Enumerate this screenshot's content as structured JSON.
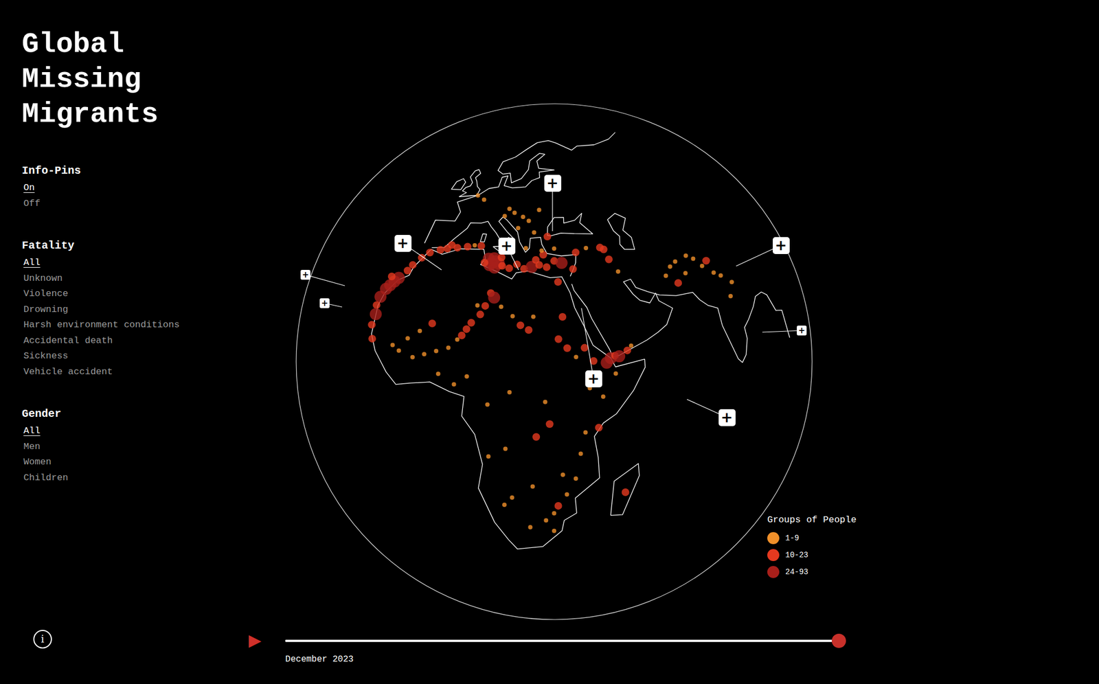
{
  "title": "Global Missing Migrants",
  "filters": [
    {
      "heading": "Info-Pins",
      "options": [
        {
          "label": "On",
          "selected": true
        },
        {
          "label": "Off",
          "selected": false
        }
      ]
    },
    {
      "heading": "Fatality",
      "options": [
        {
          "label": "All",
          "selected": true
        },
        {
          "label": "Unknown",
          "selected": false
        },
        {
          "label": "Violence",
          "selected": false
        },
        {
          "label": "Drowning",
          "selected": false
        },
        {
          "label": "Harsh environment conditions",
          "selected": false
        },
        {
          "label": "Accidental death",
          "selected": false
        },
        {
          "label": "Sickness",
          "selected": false
        },
        {
          "label": "Vehicle accident",
          "selected": false
        }
      ]
    },
    {
      "heading": "Gender",
      "options": [
        {
          "label": "All",
          "selected": true
        },
        {
          "label": "Men",
          "selected": false
        },
        {
          "label": "Women",
          "selected": false
        },
        {
          "label": "Children",
          "selected": false
        }
      ]
    }
  ],
  "info_button": {
    "icon": "i"
  },
  "timeline": {
    "play_icon": "▶",
    "level": 1.0,
    "date": "December 2023"
  },
  "legend": {
    "title": "Groups of People",
    "items": [
      {
        "label": "1-9",
        "color": "#f0902a"
      },
      {
        "label": "10-23",
        "color": "#e5391f"
      },
      {
        "label": "24-93",
        "color": "#a81f1a"
      }
    ]
  },
  "map": {
    "pins": [
      {
        "icon": "+",
        "kind": "large"
      },
      {
        "icon": "+",
        "kind": "large"
      },
      {
        "icon": "+",
        "kind": "large"
      },
      {
        "icon": "+",
        "kind": "small"
      },
      {
        "icon": "+",
        "kind": "small"
      },
      {
        "icon": "+",
        "kind": "large"
      },
      {
        "icon": "+",
        "kind": "small"
      },
      {
        "icon": "+",
        "kind": "large"
      },
      {
        "icon": "+",
        "kind": "large"
      }
    ],
    "incidents": [
      [
        13,
        34,
        2
      ],
      [
        14,
        34.5,
        2
      ],
      [
        12.5,
        33.5,
        2
      ],
      [
        15,
        34,
        2
      ],
      [
        13.5,
        35.2,
        2
      ],
      [
        12,
        35,
        2
      ],
      [
        14,
        33,
        2
      ],
      [
        16,
        33.5,
        1
      ],
      [
        11,
        34,
        1
      ],
      [
        15.5,
        35.5,
        1
      ],
      [
        18,
        33,
        1
      ],
      [
        20,
        34,
        1
      ],
      [
        22,
        33,
        1
      ],
      [
        24,
        33.5,
        2
      ],
      [
        26,
        34,
        1
      ],
      [
        28,
        33.5,
        1
      ],
      [
        25,
        35.2,
        1
      ],
      [
        27,
        36.5,
        1
      ],
      [
        30,
        35,
        1
      ],
      [
        32,
        34.5,
        2
      ],
      [
        26.5,
        37.5,
        0
      ],
      [
        22,
        38,
        0
      ],
      [
        -3,
        36,
        1
      ],
      [
        -1,
        36.5,
        1
      ],
      [
        0,
        37.5,
        1
      ],
      [
        2,
        37,
        1
      ],
      [
        5,
        37.5,
        1
      ],
      [
        7,
        38,
        0
      ],
      [
        9,
        38,
        1
      ],
      [
        -13,
        28,
        2
      ],
      [
        -14,
        27,
        2
      ],
      [
        -15,
        26,
        2
      ],
      [
        -16,
        25,
        2
      ],
      [
        -15.5,
        28,
        1
      ],
      [
        -17,
        23,
        2
      ],
      [
        -17.5,
        21,
        1
      ],
      [
        -17,
        19,
        2
      ],
      [
        -17.5,
        16.5,
        1
      ],
      [
        -16.5,
        13.5,
        1
      ],
      [
        -11,
        30,
        1
      ],
      [
        -10,
        31.5,
        1
      ],
      [
        -8,
        33.5,
        1
      ],
      [
        -6,
        35,
        1
      ],
      [
        8,
        17,
        1
      ],
      [
        9,
        18.5,
        1
      ],
      [
        7,
        16,
        0
      ],
      [
        10,
        20,
        1
      ],
      [
        12,
        22,
        1
      ],
      [
        13,
        24,
        1
      ],
      [
        14,
        27,
        1
      ],
      [
        15,
        26,
        2
      ],
      [
        11,
        24,
        0
      ],
      [
        17,
        24,
        0
      ],
      [
        20,
        22,
        0
      ],
      [
        22,
        20,
        1
      ],
      [
        24,
        19,
        1
      ],
      [
        25,
        22,
        0
      ],
      [
        5,
        14,
        0
      ],
      [
        2,
        13,
        0
      ],
      [
        -1,
        12,
        0
      ],
      [
        -4,
        11,
        0
      ],
      [
        -8,
        12,
        0
      ],
      [
        0,
        19,
        1
      ],
      [
        -3,
        17,
        0
      ],
      [
        -6,
        15,
        0
      ],
      [
        -10,
        13,
        0
      ],
      [
        31,
        30,
        1
      ],
      [
        32,
        22,
        1
      ],
      [
        31,
        17,
        1
      ],
      [
        33,
        15,
        1
      ],
      [
        35,
        13,
        0
      ],
      [
        37,
        15,
        1
      ],
      [
        39,
        12,
        1
      ],
      [
        40,
        9,
        0
      ],
      [
        42,
        11.5,
        2
      ],
      [
        43,
        12.5,
        2
      ],
      [
        44,
        13,
        1
      ],
      [
        45,
        12.8,
        2
      ],
      [
        47,
        14,
        1
      ],
      [
        48,
        15,
        0
      ],
      [
        44,
        9,
        0
      ],
      [
        41,
        4,
        0
      ],
      [
        38,
        6,
        0
      ],
      [
        28,
        41,
        1
      ],
      [
        30,
        38,
        0
      ],
      [
        36,
        37,
        1
      ],
      [
        39,
        38,
        0
      ],
      [
        43,
        38,
        1
      ],
      [
        45,
        35,
        1
      ],
      [
        47,
        32,
        0
      ],
      [
        44,
        37.5,
        1
      ],
      [
        35,
        33,
        1
      ],
      [
        2,
        51,
        0
      ],
      [
        5,
        50,
        0
      ],
      [
        15,
        48,
        0
      ],
      [
        20,
        46,
        0
      ],
      [
        22,
        45,
        0
      ],
      [
        19,
        43,
        0
      ],
      [
        24,
        42,
        0
      ],
      [
        17,
        47,
        0
      ],
      [
        14,
        46,
        0
      ],
      [
        25,
        48,
        0
      ],
      [
        62,
        32,
        0
      ],
      [
        64,
        33,
        0
      ],
      [
        66,
        30,
        0
      ],
      [
        68,
        34,
        0
      ],
      [
        70,
        33,
        0
      ],
      [
        72,
        31,
        0
      ],
      [
        74,
        32,
        1
      ],
      [
        75,
        29,
        0
      ],
      [
        77,
        28,
        0
      ],
      [
        78,
        23,
        0
      ],
      [
        80,
        26,
        0
      ],
      [
        63,
        28,
        1
      ],
      [
        60,
        30,
        0
      ],
      [
        28,
        -26,
        0
      ],
      [
        30,
        -24,
        0
      ],
      [
        31,
        -22,
        1
      ],
      [
        33,
        -19,
        0
      ],
      [
        35,
        -15,
        0
      ],
      [
        32,
        -14,
        0
      ],
      [
        25,
        -17,
        0
      ],
      [
        18,
        -22,
        0
      ],
      [
        20,
        -20,
        0
      ],
      [
        36,
        -9,
        0
      ],
      [
        37,
        -4,
        0
      ],
      [
        40,
        -3,
        1
      ],
      [
        47,
        -19,
        1
      ],
      [
        30,
        -29,
        0
      ],
      [
        24,
        -28,
        0
      ],
      [
        15,
        -10,
        0
      ],
      [
        19,
        -8,
        0
      ],
      [
        26,
        -5,
        1
      ],
      [
        29,
        -2,
        1
      ],
      [
        28,
        3,
        0
      ],
      [
        20,
        5,
        0
      ],
      [
        10,
        8,
        0
      ],
      [
        7,
        6,
        0
      ],
      [
        3,
        8,
        0
      ],
      [
        15,
        2,
        0
      ]
    ]
  }
}
